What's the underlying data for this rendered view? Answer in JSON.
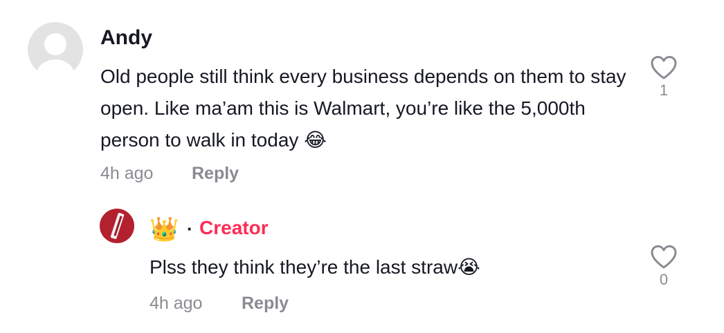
{
  "comments": [
    {
      "username": "Andy",
      "text": "Old people still think every business depends on them to stay open. Like ma’am this is Walmart, you’re like the 5,000th person to walk in today 😂",
      "time": "4h ago",
      "reply_label": "Reply",
      "like_count": "1",
      "avatar_icon": "default-user-avatar"
    }
  ],
  "reply": {
    "badge_emoji": "👑",
    "separator": "·",
    "creator_label": "Creator",
    "text": "Plss they think they’re the last straw😭",
    "time": "4h ago",
    "reply_label": "Reply",
    "like_count": "0",
    "avatar_icon": "red-logo-avatar"
  },
  "colors": {
    "creator": "#fe2c55",
    "meta": "#8a8b91",
    "text": "#161823"
  }
}
